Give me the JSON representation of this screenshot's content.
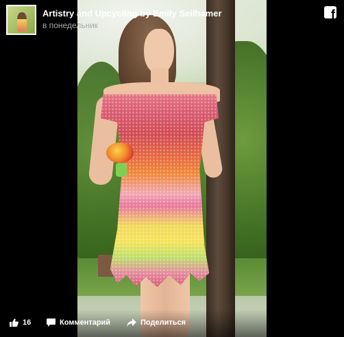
{
  "post": {
    "page_name": "Artistry and Upcycling by Emily Seilhamer",
    "timestamp": "в понедельник",
    "brand_icon": "facebook-icon",
    "brand_letter": "f"
  },
  "actions": {
    "likes_count": "16",
    "comment_label": "Комментарий",
    "share_label": "Поделиться"
  },
  "colors": {
    "background": "#000000",
    "text": "#ffffff",
    "subtext": "#aaaaaa"
  }
}
